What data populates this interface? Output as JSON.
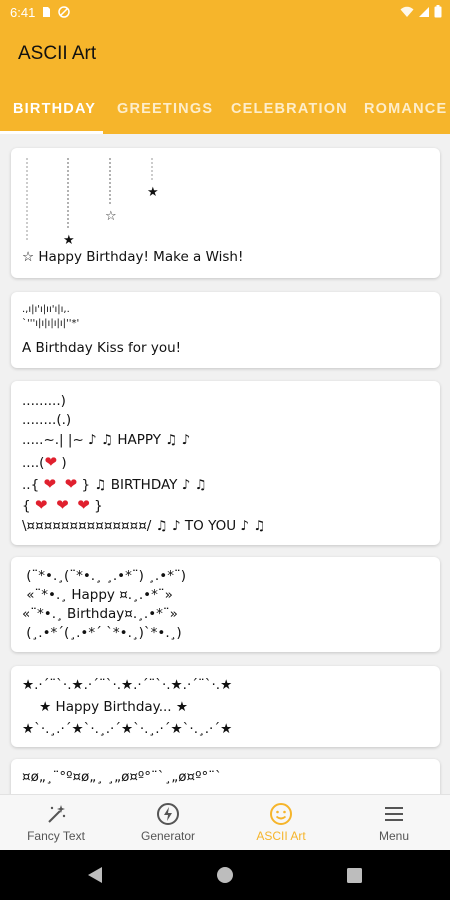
{
  "status_bar": {
    "time": "6:41"
  },
  "app_bar": {
    "title": "ASCII Art"
  },
  "tabs": [
    {
      "label": "BIRTHDAY",
      "active": true
    },
    {
      "label": "GREETINGS",
      "active": false
    },
    {
      "label": "CELEBRATION",
      "active": false
    },
    {
      "label": "ROMANCE",
      "active": false
    }
  ],
  "cards": [
    {
      "lines": [
        "☆ Happy Birthday! Make a Wish!"
      ]
    },
    {
      "lines": [
        ".,ı|ı'ı|ıı'ı|ı,.",
        "`'''ı|ı|ı|ı|ı|''*'",
        "A Birthday Kiss for you!"
      ]
    },
    {
      "lines": [
        ".........)",
        "........(.)",
        ".....~.| |~ ♪ ♫ HAPPY ♫ ♪",
        "....(",
        "..{",
        "{",
        "\\¤¤¤¤¤¤¤¤¤¤¤¤¤¤/ ♫ ♪ TO YOU ♪ ♫"
      ],
      "row4_tail": ")",
      "row5_tail": "} ♫ BIRTHDAY ♪ ♫",
      "row6_tail": "}"
    },
    {
      "lines": [
        " (¨*•.¸(¨*•.¸ ¸.•*¨) ¸.•*¨)",
        " «¨*•.¸ Happy ¤.¸.•*¨»",
        "«¨*•.¸ Birthday¤.¸.•*¨»",
        " (¸.•*´(¸.•*´ `*•.¸)`*•.¸)"
      ]
    },
    {
      "lines": [
        "★.·´¨`·.★.·´¨`·.★.·´¨`·.★.·´¨`·.★",
        "    ★ Happy Birthday... ★",
        "★`·.¸.·´★`·.¸.·´★`·.¸.·´★`·.¸.·´★"
      ]
    },
    {
      "lines": [
        "¤ø„¸¨°º¤ø„¸ ¸„ø¤º°¨`¸„ø¤º°¨`"
      ]
    }
  ],
  "bottom_nav": [
    {
      "label": "Fancy Text",
      "icon": "magic-wand-icon",
      "active": false
    },
    {
      "label": "Generator",
      "icon": "lightning-bolt-icon",
      "active": false
    },
    {
      "label": "ASCII Art",
      "icon": "smiley-face-icon",
      "active": true
    },
    {
      "label": "Menu",
      "icon": "hamburger-menu-icon",
      "active": false
    }
  ],
  "colors": {
    "primary": "#f6b52b",
    "accent_text": "#f6b52b",
    "heart": "#e0202e"
  }
}
